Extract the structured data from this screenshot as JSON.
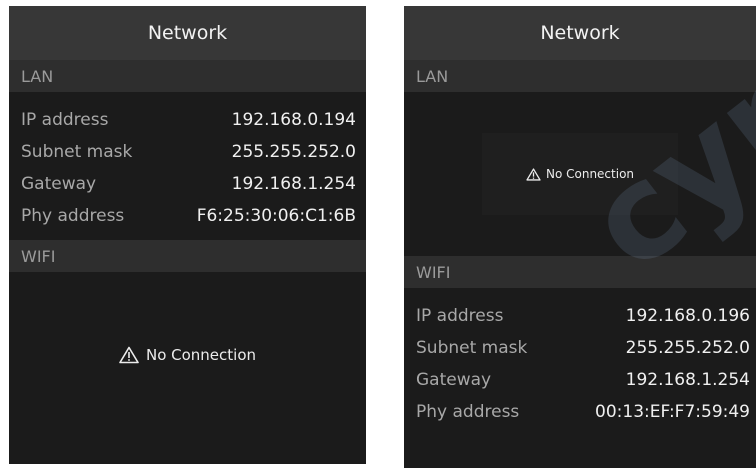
{
  "screens": [
    {
      "title": "Network",
      "lan": {
        "header": "LAN",
        "rows": [
          {
            "label": "IP address",
            "value": "192.168.0.194"
          },
          {
            "label": "Subnet mask",
            "value": "255.255.252.0"
          },
          {
            "label": "Gateway",
            "value": "192.168.1.254"
          },
          {
            "label": "Phy address",
            "value": "F6:25:30:06:C1:6B"
          }
        ]
      },
      "wifi": {
        "header": "WIFI",
        "status": "No Connection"
      }
    },
    {
      "title": "Network",
      "lan": {
        "header": "LAN",
        "status": "No Connection"
      },
      "wifi": {
        "header": "WIFI",
        "rows": [
          {
            "label": "IP address",
            "value": "192.168.0.196"
          },
          {
            "label": "Subnet mask",
            "value": "255.255.252.0"
          },
          {
            "label": "Gateway",
            "value": "192.168.1.254"
          },
          {
            "label": "Phy address",
            "value": "00:13:EF:F7:59:49"
          }
        ]
      }
    }
  ],
  "icons": {
    "warning": "warning-triangle-icon"
  },
  "colors": {
    "screen_bg": "#1b1b1b",
    "title_bar_bg": "#373737",
    "section_header_bg": "#2e2e2e",
    "label_text": "#a8a8a8",
    "value_text": "#f0f0f0"
  },
  "watermark": "cyne"
}
